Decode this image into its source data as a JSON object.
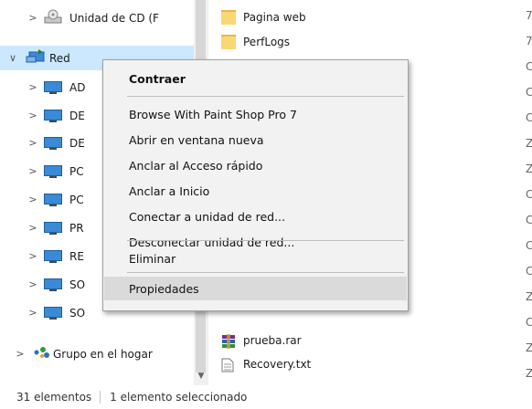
{
  "sidebar": {
    "items": [
      {
        "label": "Unidad de CD (F",
        "chevron": ">",
        "icon": "cd-drive-icon"
      },
      {
        "label": "Red",
        "chevron": "∨",
        "icon": "network-icon"
      },
      {
        "label": "AD",
        "chevron": ">",
        "icon": "computer-icon"
      },
      {
        "label": "DE",
        "chevron": ">",
        "icon": "computer-icon"
      },
      {
        "label": "DE",
        "chevron": ">",
        "icon": "computer-icon"
      },
      {
        "label": "PC",
        "chevron": ">",
        "icon": "computer-icon"
      },
      {
        "label": "PC",
        "chevron": ">",
        "icon": "computer-icon"
      },
      {
        "label": "PR",
        "chevron": ">",
        "icon": "computer-icon"
      },
      {
        "label": "RE",
        "chevron": ">",
        "icon": "computer-icon"
      },
      {
        "label": "SO",
        "chevron": ">",
        "icon": "computer-icon"
      },
      {
        "label": "SO",
        "chevron": ">",
        "icon": "computer-icon"
      },
      {
        "label": "Grupo en el hogar",
        "chevron": ">",
        "icon": "homegroup-icon"
      }
    ]
  },
  "files": [
    {
      "name": "Pagina web",
      "icon": "folder-icon"
    },
    {
      "name": "PerfLogs",
      "icon": "folder-icon"
    },
    {
      "name": "prueba.rar",
      "icon": "rar-archive-icon"
    },
    {
      "name": "Recovery.txt",
      "icon": "text-file-icon"
    }
  ],
  "right_column": [
    "7",
    "7",
    "C",
    "C",
    "C",
    "Z",
    "Z",
    "C",
    "C",
    "C",
    "C",
    "Z",
    "C",
    "Z",
    "Z"
  ],
  "context_menu": {
    "items": [
      {
        "label": "Contraer",
        "bold": true
      },
      {
        "label": "Browse With Paint Shop Pro 7"
      },
      {
        "label": "Abrir en ventana nueva"
      },
      {
        "label": "Anclar al Acceso rápido"
      },
      {
        "label": "Anclar a Inicio"
      },
      {
        "label": "Conectar a unidad de red..."
      },
      {
        "label": "Desconectar unidad de red..."
      },
      {
        "label": "Eliminar"
      },
      {
        "label": "Propiedades",
        "highlighted": true
      }
    ]
  },
  "status_bar": {
    "count": "31 elementos",
    "selection": "1 elemento seleccionado"
  },
  "colors": {
    "selection": "#cce8ff",
    "menu_background": "#f2f2f2",
    "menu_highlight": "#dadada",
    "folder": "#f8d775"
  }
}
